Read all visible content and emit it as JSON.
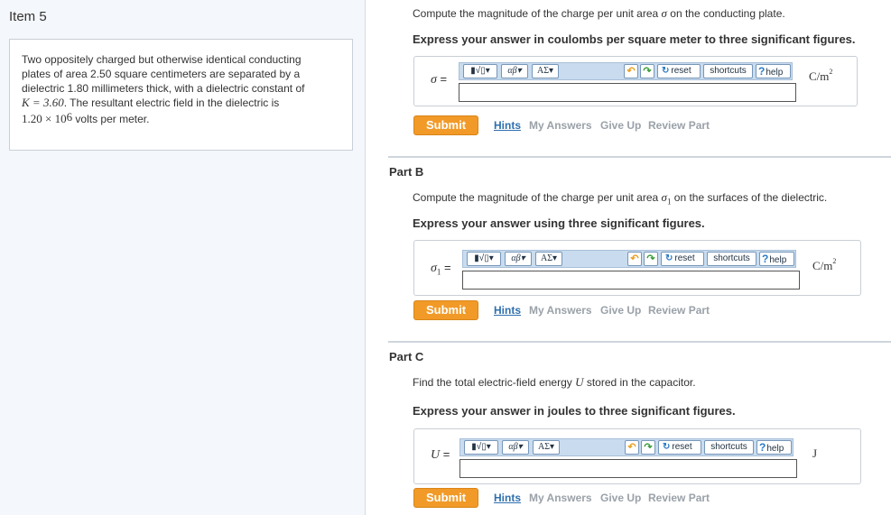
{
  "item_title": "Item 5",
  "problem": {
    "line1": "Two oppositely charged but otherwise identical conducting",
    "line2": "plates of area 2.50 square centimeters are separated by a",
    "line3": "dielectric 1.80 millimeters thick, with a dielectric constant of",
    "k_math": "K = 3.60",
    "line4_rest": ". The resultant electric field in the dielectric is",
    "e_mantissa": "1.20 × 10",
    "e_exp": "6",
    "e_rest": " volts per meter."
  },
  "toolbar": {
    "sqrt_label": "▮√▯▾",
    "greek_label": "αβ▾",
    "sigma_label": "ΑΣ▾",
    "undo_label": "↶",
    "redo_label": "↷",
    "reset_label": "reset",
    "shortcuts_label": "shortcuts",
    "help_label": "help"
  },
  "links": {
    "submit": "Submit",
    "hints": "Hints",
    "my_answers": "My Answers",
    "give_up": "Give Up",
    "review_part": "Review Part"
  },
  "part_a": {
    "intro_before": "Compute the magnitude of the charge per unit area ",
    "intro_var": "σ",
    "intro_after": " on the conducting plate.",
    "instruction": "Express your answer in coulombs per square meter to three significant figures.",
    "symbol": "σ",
    "equals": " =",
    "unit_base": "C/m",
    "unit_exp": "2",
    "input_value": ""
  },
  "part_b": {
    "title": "Part B",
    "intro_before": "Compute the magnitude of the charge per unit area ",
    "intro_var": "σ",
    "intro_sub": "1",
    "intro_after": " on the surfaces of the dielectric.",
    "instruction": "Express your answer using three significant figures.",
    "symbol": "σ",
    "symbol_sub": "1",
    "equals": " =",
    "unit_base": "C/m",
    "unit_exp": "2",
    "input_value": ""
  },
  "part_c": {
    "title": "Part C",
    "intro_before": "Find the total electric-field energy ",
    "intro_var": "U",
    "intro_after": " stored in the capacitor.",
    "instruction": "Express your answer in joules to three significant figures.",
    "symbol": "U",
    "equals": " =",
    "unit": "J",
    "input_value": ""
  }
}
